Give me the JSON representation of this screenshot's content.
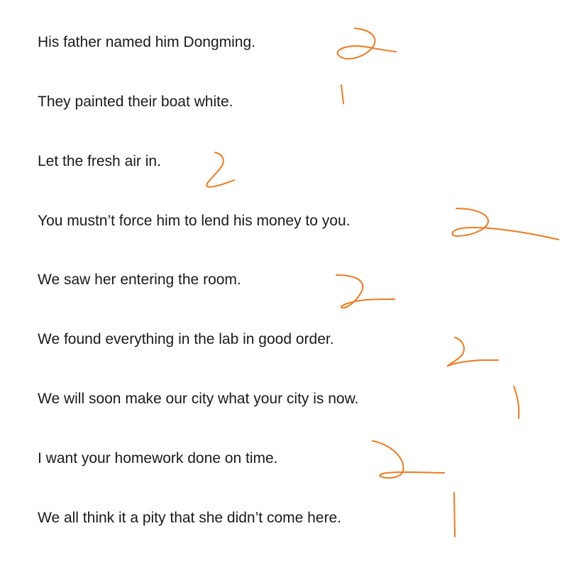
{
  "sentences": [
    "His father named him Dongming.",
    "They painted their boat white.",
    "Let the fresh air in.",
    "You mustn’t force him to lend his money to you.",
    "We saw her entering the room.",
    "We found everything in the lab in good order.",
    "We will soon make our city what your city is now.",
    "I want your homework done on time.",
    " We all think it a pity that she didn’t come here."
  ],
  "annotations": {
    "ink_color": "#f07a1c",
    "marks": [
      "2",
      "1",
      "2",
      "2",
      "2",
      "2",
      "1",
      "2",
      "1"
    ]
  }
}
